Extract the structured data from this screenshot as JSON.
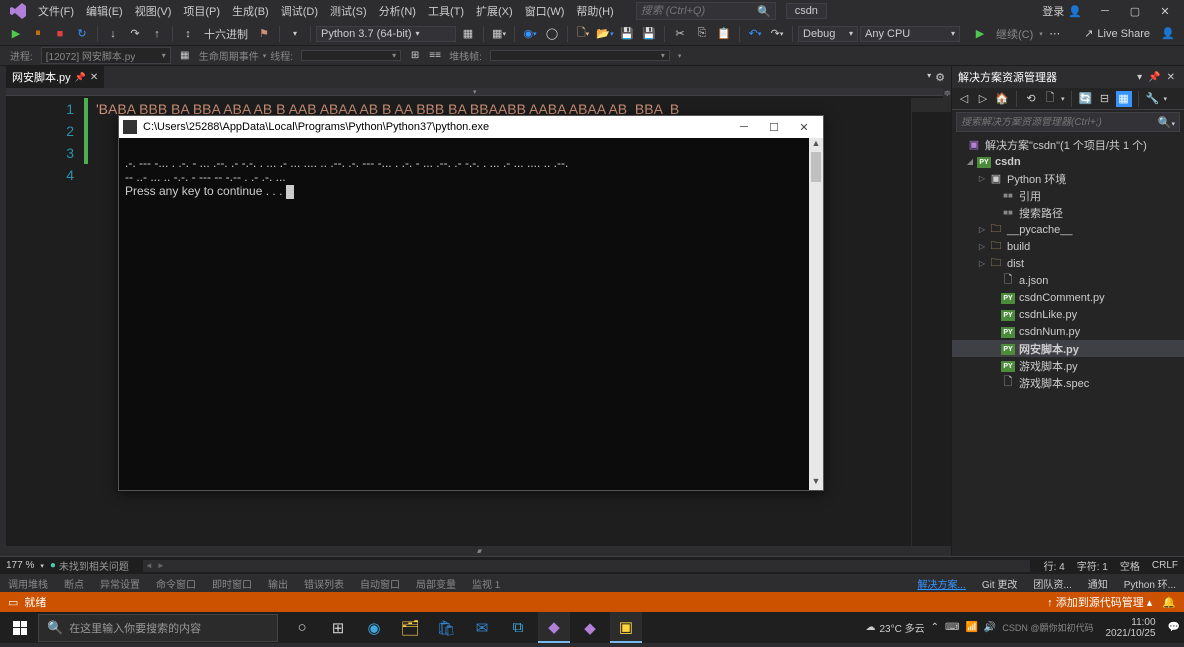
{
  "menu": {
    "items": [
      "文件(F)",
      "编辑(E)",
      "视图(V)",
      "项目(P)",
      "生成(B)",
      "调试(D)",
      "测试(S)",
      "分析(N)",
      "工具(T)",
      "扩展(X)",
      "窗口(W)",
      "帮助(H)"
    ],
    "search_placeholder": "搜索 (Ctrl+Q)",
    "project_name": "csdn",
    "login": "登录"
  },
  "toolbar": {
    "hex": "十六进制",
    "python": "Python 3.7 (64-bit)",
    "debug": "Debug",
    "cpu": "Any CPU",
    "continue": "继续(C)",
    "liveshare": "Live Share"
  },
  "toolbar2": {
    "process_lbl": "进程:",
    "process_val": "[12072] 网安脚本.py",
    "lifecycle_lbl": "生命周期事件",
    "thread_lbl": "线程:",
    "stack_lbl": "堆栈帧:"
  },
  "tab": {
    "name": "网安脚本.py"
  },
  "code": {
    "line1_partial": "'BABA BBB BA BBA ABA AB B AAB ABAA AB B AA BBB BA BBAABB AABA ABAA AB  BBA  B"
  },
  "console": {
    "title": "C:\\Users\\25288\\AppData\\Local\\Programs\\Python\\Python37\\python.exe",
    "line1": ".-. --- -... . .-. - ... .--. .- -.-. . ... .- ... .... .. .--. .-. --- -... . .-. - ... .--. .- -.-. . ... .- ... .... .. .--.",
    "line2": "-- ..- ... .. -.-. - --- -- -.-- . .- .-. ...",
    "line3": "Press any key to continue . . . "
  },
  "solution": {
    "title": "解决方案资源管理器",
    "search_placeholder": "搜索解决方案资源管理器(Ctrl+;)",
    "root": "解决方案\"csdn\"(1 个项目/共 1 个)",
    "project": "csdn",
    "nodes": {
      "env": "Python 环境",
      "ref": "引用",
      "search": "搜索路径",
      "pycache": "__pycache__",
      "build": "build",
      "dist": "dist",
      "ajson": "a.json",
      "csdnComment": "csdnComment.py",
      "csdnLike": "csdnLike.py",
      "csdnNum": "csdnNum.py",
      "wangan": "网安脚本.py",
      "youxi_py": "游戏脚本.py",
      "youxi_spec": "游戏脚本.spec"
    }
  },
  "infobar": {
    "zoom": "177 %",
    "noissues": "未找到相关问题",
    "line": "行: 4",
    "col": "字符: 1",
    "space": "空格",
    "eol": "CRLF"
  },
  "bottomtabs": {
    "left": [
      "调用堆栈",
      "断点",
      "异常设置",
      "命令窗口",
      "即时窗口",
      "输出",
      "错误列表",
      "自动窗口",
      "局部变量",
      "监视 1"
    ],
    "right": [
      "解决方案...",
      "Git 更改",
      "团队资...",
      "通知",
      "Python 环..."
    ]
  },
  "statusbar": {
    "ready": "就绪",
    "addsrc": "添加到源代码管理"
  },
  "taskbar": {
    "search": "在这里输入你要搜索的内容",
    "weather": "23°C 多云",
    "time": "11:00",
    "date": "2021/10/25",
    "watermark": "CSDN @願你如初代码"
  }
}
